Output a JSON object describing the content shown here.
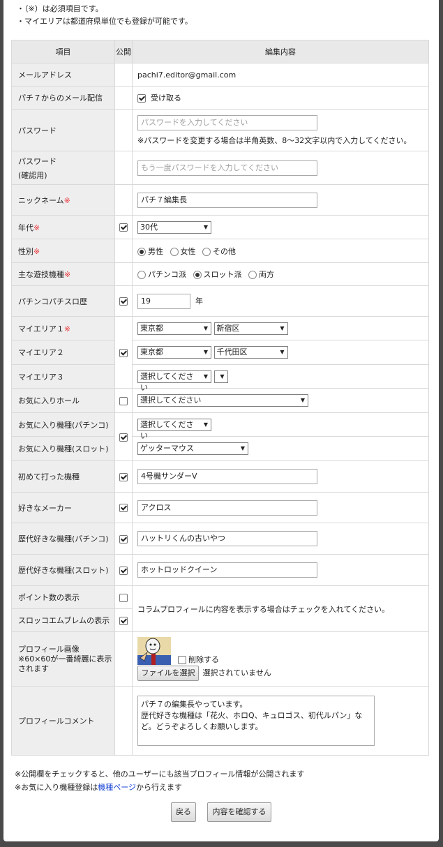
{
  "notes_top": [
    "・（※）は必須項目です。",
    "・マイエリアは都道府県単位でも登録が可能です。"
  ],
  "headers": {
    "item": "項目",
    "public": "公開",
    "content": "編集内容"
  },
  "labels": {
    "email": "メールアドレス",
    "mail_delivery": "パチ７からのメール配信",
    "password": "パスワード",
    "password_confirm_1": "パスワード",
    "password_confirm_2": "(確認用)",
    "nickname": "ニックネーム",
    "age": "年代",
    "gender": "性別",
    "main_game": "主な遊技機種",
    "history": "パチンコパチスロ歴",
    "area1": "マイエリア１",
    "area2": "マイエリア２",
    "area3": "マイエリア３",
    "fav_hall": "お気に入りホール",
    "fav_pachinko": "お気に入り機種(パチンコ)",
    "fav_slot": "お気に入り機種(スロット)",
    "first_machine": "初めて打った機種",
    "maker": "好きなメーカー",
    "best_pachinko": "歴代好きな機種(パチンコ)",
    "best_slot": "歴代好きな機種(スロット)",
    "points": "ポイント数の表示",
    "emblem": "スロッコエムブレムの表示",
    "profile_image_1": "プロフィール画像",
    "profile_image_2": "※60×60が一番綺麗に表示",
    "profile_image_3": "されます",
    "comment": "プロフィールコメント"
  },
  "required_mark": "※",
  "values": {
    "email": "pachi7.editor@gmail.com",
    "mail_delivery_label": "受け取る",
    "password_placeholder": "パスワードを入力してください",
    "password_hint": "※パスワードを変更する場合は半角英数、8～32文字以内で入力してください。",
    "password_confirm_placeholder": "もう一度パスワードを入力してください",
    "nickname": "パチ７編集長",
    "age": "30代",
    "gender_options": [
      "男性",
      "女性",
      "その他"
    ],
    "game_options": [
      "パチンコ派",
      "スロット派",
      "両方"
    ],
    "history": "19",
    "history_unit": "年",
    "area1_pref": "東京都",
    "area1_city": "新宿区",
    "area2_pref": "東京都",
    "area2_city": "千代田区",
    "area3_pref": "選択してください",
    "fav_hall": "選択してください",
    "fav_pachinko": "選択してください",
    "fav_slot": "ゲッターマウス",
    "first_machine": "4号機サンダーV",
    "maker": "アクロス",
    "best_pachinko": "ハットリくんの古いやつ",
    "best_slot": "ホットロッドクイーン",
    "display_hint": "コラムプロフィールに内容を表示する場合はチェックを入れてください。",
    "delete_label": "削除する",
    "file_button": "ファイルを選択",
    "file_status": "選択されていません",
    "comment": "パチ７の編集長やっています。\n歴代好きな機種は「花火、ホロQ、キュロゴス、初代ルパン」など。どうぞよろしくお願いします。"
  },
  "notes_bottom": {
    "line1": "※公開欄をチェックすると、他のユーザーにも該当プロフィール情報が公開されます",
    "line2_before": "※お気に入り機種登録は",
    "line2_link": "機種ページ",
    "line2_after": "から行えます"
  },
  "buttons": {
    "back": "戻る",
    "confirm": "内容を確認する"
  },
  "colors": {
    "required": "#e8343a",
    "link": "#1a44d6",
    "header_bg": "#e9e9e9",
    "label_bg": "#eeeeee"
  }
}
